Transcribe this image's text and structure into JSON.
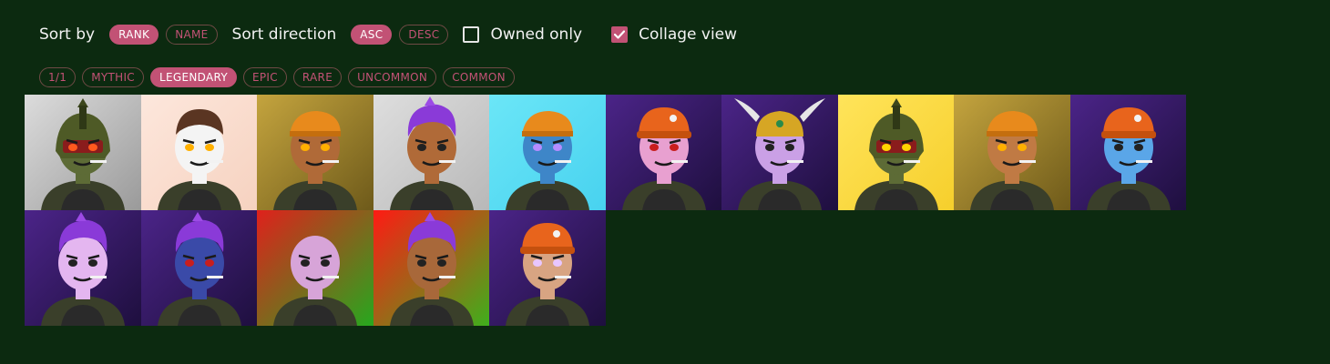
{
  "controls": {
    "sort_by_label": "Sort by",
    "sort_options": [
      {
        "label": "RANK",
        "active": true
      },
      {
        "label": "NAME",
        "active": false
      }
    ],
    "direction_label": "Sort direction",
    "direction_options": [
      {
        "label": "ASC",
        "active": true
      },
      {
        "label": "DESC",
        "active": false
      }
    ],
    "owned_only": {
      "label": "Owned only",
      "checked": false
    },
    "collage_view": {
      "label": "Collage view",
      "checked": true
    }
  },
  "rarity_filters": [
    {
      "label": "1/1",
      "active": false
    },
    {
      "label": "MYTHIC",
      "active": false
    },
    {
      "label": "LEGENDARY",
      "active": true
    },
    {
      "label": "EPIC",
      "active": false
    },
    {
      "label": "RARE",
      "active": false
    },
    {
      "label": "UNCOMMON",
      "active": false
    },
    {
      "label": "COMMON",
      "active": false
    }
  ],
  "colors": {
    "background": "#0c2a10",
    "accent": "#c25275"
  },
  "collage": [
    {
      "bg": [
        "#dcdcdc",
        "#9a9a9a"
      ],
      "skin": "#5d6b36",
      "head": "helmet-green",
      "eyes": "#ff5a1e"
    },
    {
      "bg": [
        "#fde7dc",
        "#f6d2c0"
      ],
      "skin": "#f4f4f4",
      "head": "brown-hair",
      "eyes": "#ffb000"
    },
    {
      "bg": [
        "#c4a43e",
        "#6e5a1a"
      ],
      "skin": "#b06a38",
      "head": "orange-cap",
      "eyes": "#ffb000"
    },
    {
      "bg": [
        "#dedede",
        "#b8b8b8"
      ],
      "skin": "#b06a38",
      "head": "purple-hair",
      "eyes": "#222222"
    },
    {
      "bg": [
        "#6be6f7",
        "#48d2ef"
      ],
      "skin": "#3e86c8",
      "head": "orange-cap",
      "eyes": "#b58cff"
    },
    {
      "bg": [
        "#4b2488",
        "#1e0f3e"
      ],
      "skin": "#e8a0d0",
      "head": "orange-beanie",
      "eyes": "#c81e1e"
    },
    {
      "bg": [
        "#4b2488",
        "#1e0f3e"
      ],
      "skin": "#caa0e6",
      "head": "gold-helmet",
      "eyes": "#222222"
    },
    {
      "bg": [
        "#ffe45a",
        "#f6cf2c"
      ],
      "skin": "#5d6b36",
      "head": "helmet-green",
      "eyes": "#ffd400"
    },
    {
      "bg": [
        "#c4a43e",
        "#6e5a1a"
      ],
      "skin": "#c07a44",
      "head": "orange-cap",
      "eyes": "#ffb000"
    },
    {
      "bg": [
        "#4b2488",
        "#1e0f3e"
      ],
      "skin": "#5aa6e8",
      "head": "orange-beanie",
      "eyes": "#222222"
    },
    {
      "bg": [
        "#4b2488",
        "#1e0f3e"
      ],
      "skin": "#e4b6f0",
      "head": "purple-hair",
      "eyes": "#222222"
    },
    {
      "bg": [
        "#4b2488",
        "#1e0f3e"
      ],
      "skin": "#3a4aa8",
      "head": "purple-hair",
      "eyes": "#c81e1e"
    },
    {
      "bg": [
        "#e0201c",
        "#26a81e"
      ],
      "skin": "#d7a4d8",
      "head": "bald",
      "eyes": "#222222"
    },
    {
      "bg": [
        "#ff1a14",
        "#3eb01c"
      ],
      "skin": "#a8683a",
      "head": "purple-hair",
      "eyes": "#222222"
    },
    {
      "bg": [
        "#4b2488",
        "#1e0f3e"
      ],
      "skin": "#d8a482",
      "head": "orange-beanie",
      "eyes": "#e8c6ff"
    }
  ]
}
